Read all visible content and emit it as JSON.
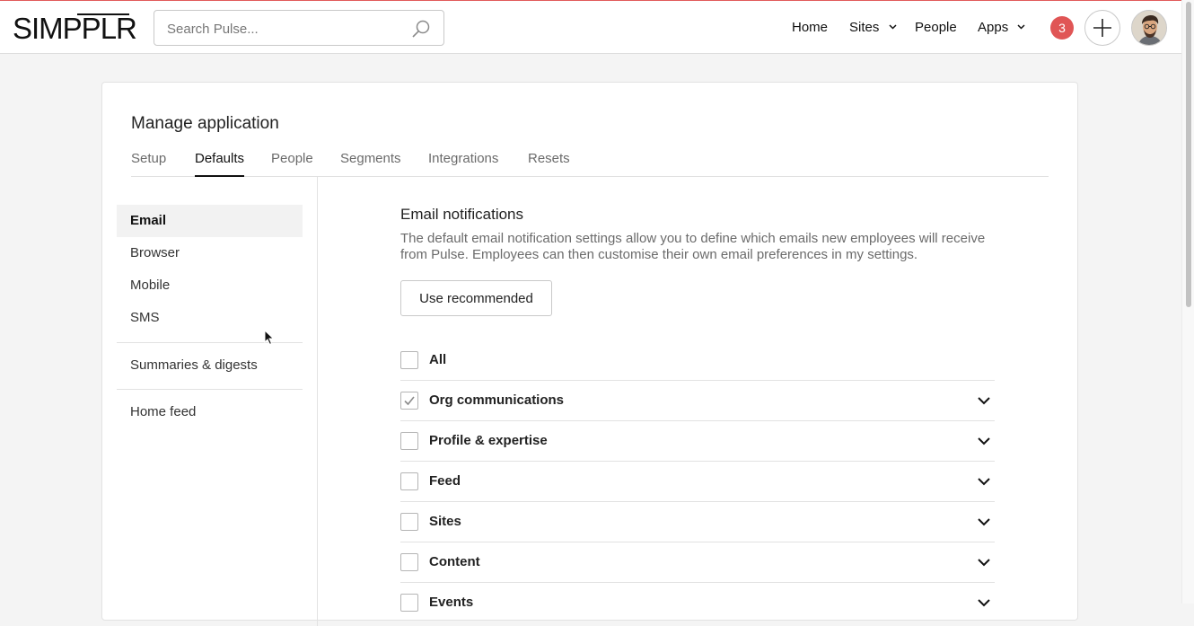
{
  "header": {
    "logo": "SIMPPLR",
    "search_placeholder": "Search Pulse...",
    "nav": [
      {
        "label": "Home"
      },
      {
        "label": "Sites"
      },
      {
        "label": "People"
      },
      {
        "label": "Apps"
      }
    ],
    "notification_count": "3"
  },
  "page": {
    "title": "Manage application",
    "tabs": [
      "Setup",
      "Defaults",
      "People",
      "Segments",
      "Integrations",
      "Resets"
    ],
    "active_tab": "Defaults"
  },
  "sidebar": {
    "items": [
      "Email",
      "Browser",
      "Mobile",
      "SMS",
      "Summaries & digests",
      "Home feed"
    ],
    "active": "Email"
  },
  "main": {
    "title": "Email notifications",
    "description": "The default email notification settings allow you to define which emails new employees will receive from Pulse. Employees can then customise their own email preferences in my settings.",
    "button": "Use recommended",
    "rows": [
      {
        "label": "All",
        "checked": false
      },
      {
        "label": "Org communications",
        "checked": true
      },
      {
        "label": "Profile & expertise",
        "checked": false
      },
      {
        "label": "Feed",
        "checked": false
      },
      {
        "label": "Sites",
        "checked": false
      },
      {
        "label": "Content",
        "checked": false
      },
      {
        "label": "Events",
        "checked": false
      }
    ]
  },
  "colors": {
    "badge": "#e05555",
    "accent": "#111111"
  }
}
